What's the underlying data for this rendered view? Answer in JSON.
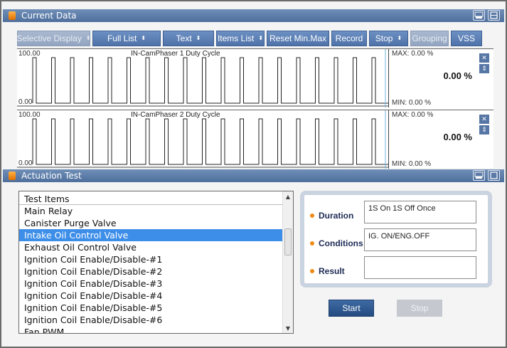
{
  "current_data": {
    "title": "Current Data",
    "toolbar": [
      {
        "label": "Selective Display",
        "disabled": true,
        "arrows": true,
        "width": 103
      },
      {
        "label": "Full List",
        "disabled": false,
        "arrows": true,
        "width": 96
      },
      {
        "label": "Text",
        "disabled": false,
        "arrows": true,
        "width": 72
      },
      {
        "label": "Items List",
        "disabled": false,
        "arrows": true,
        "width": 68
      },
      {
        "label": "Reset Min.Max",
        "disabled": false,
        "arrows": false,
        "width": 88
      },
      {
        "label": "Record",
        "disabled": false,
        "arrows": false,
        "width": 50
      },
      {
        "label": "Stop",
        "disabled": false,
        "arrows": true,
        "width": 55
      },
      {
        "label": "Grouping",
        "disabled": true,
        "arrows": false,
        "width": 54
      },
      {
        "label": "VSS",
        "disabled": false,
        "arrows": false,
        "width": 44
      }
    ],
    "graphs": [
      {
        "title": "IN-CamPhaser 1 Duty Cycle",
        "top_label": "100.00",
        "bottom_label": "0.00",
        "max": "MAX:  0.00 %",
        "min": "MIN:  0.00 %",
        "current": "0.00 %"
      },
      {
        "title": "IN-CamPhaser 2 Duty Cycle",
        "top_label": "100.00",
        "bottom_label": "0.00",
        "max": "MAX:  0.00 %",
        "min": "MIN:  0.00 %",
        "current": "0.00 %"
      }
    ]
  },
  "actuation": {
    "title": "Actuation Test",
    "list_header": "Test Items",
    "items": [
      "Main Relay",
      "Canister Purge Valve",
      "Intake Oil Control Valve",
      "Exhaust Oil Control Valve",
      "Ignition Coil Enable/Disable-#1",
      "Ignition Coil Enable/Disable-#2",
      "Ignition Coil Enable/Disable-#3",
      "Ignition Coil Enable/Disable-#4",
      "Ignition Coil Enable/Disable-#5",
      "Ignition Coil Enable/Disable-#6",
      "Fan PWM"
    ],
    "selected_index": 2,
    "params": {
      "duration_label": "Duration",
      "duration_value": "1S On 1S Off Once",
      "conditions_label": "Conditions",
      "conditions_value": "IG. ON/ENG.OFF",
      "result_label": "Result",
      "result_value": ""
    },
    "start_label": "Start",
    "stop_label": "Stop"
  },
  "colors": {
    "titlebar": "#5b7aa6",
    "accent_orange": "#ee8a12",
    "selection": "#3d8ee8"
  },
  "icons": {
    "retry": "retry-icon",
    "window": "window-icon",
    "close": "close-icon",
    "updown": "updown-icon"
  }
}
